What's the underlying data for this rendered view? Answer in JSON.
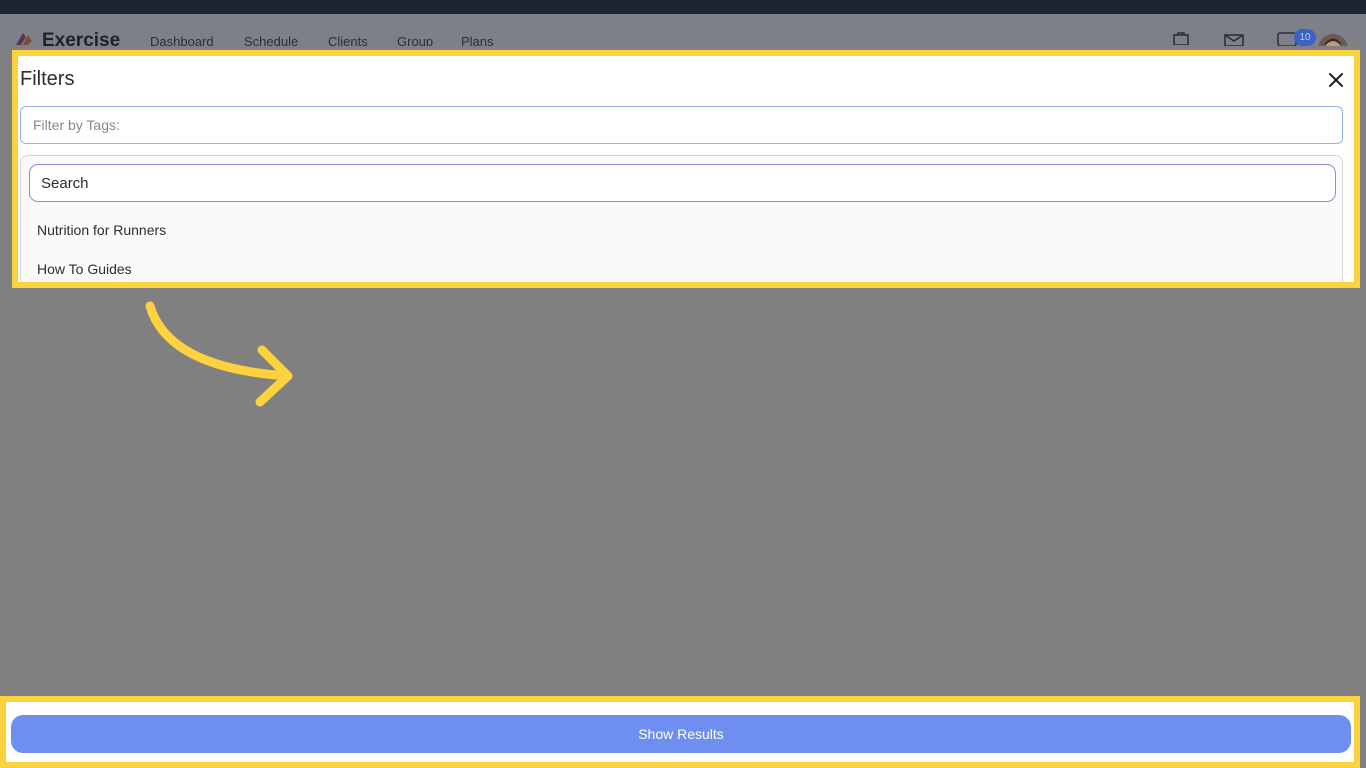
{
  "app": {
    "name": "Exercise",
    "nav": [
      "Dashboard",
      "Schedule",
      "Clients",
      "Group",
      "Plans"
    ],
    "notification_count": "10"
  },
  "filters": {
    "title": "Filters",
    "tags_placeholder": "Filter by Tags:",
    "search_placeholder": "Search",
    "options": [
      "Nutrition for Runners",
      "How To Guides"
    ]
  },
  "footer": {
    "show_results_label": "Show Results"
  },
  "colors": {
    "highlight": "#fdd23f",
    "primary_button": "#6f8ff0",
    "overlay": "#808080"
  }
}
